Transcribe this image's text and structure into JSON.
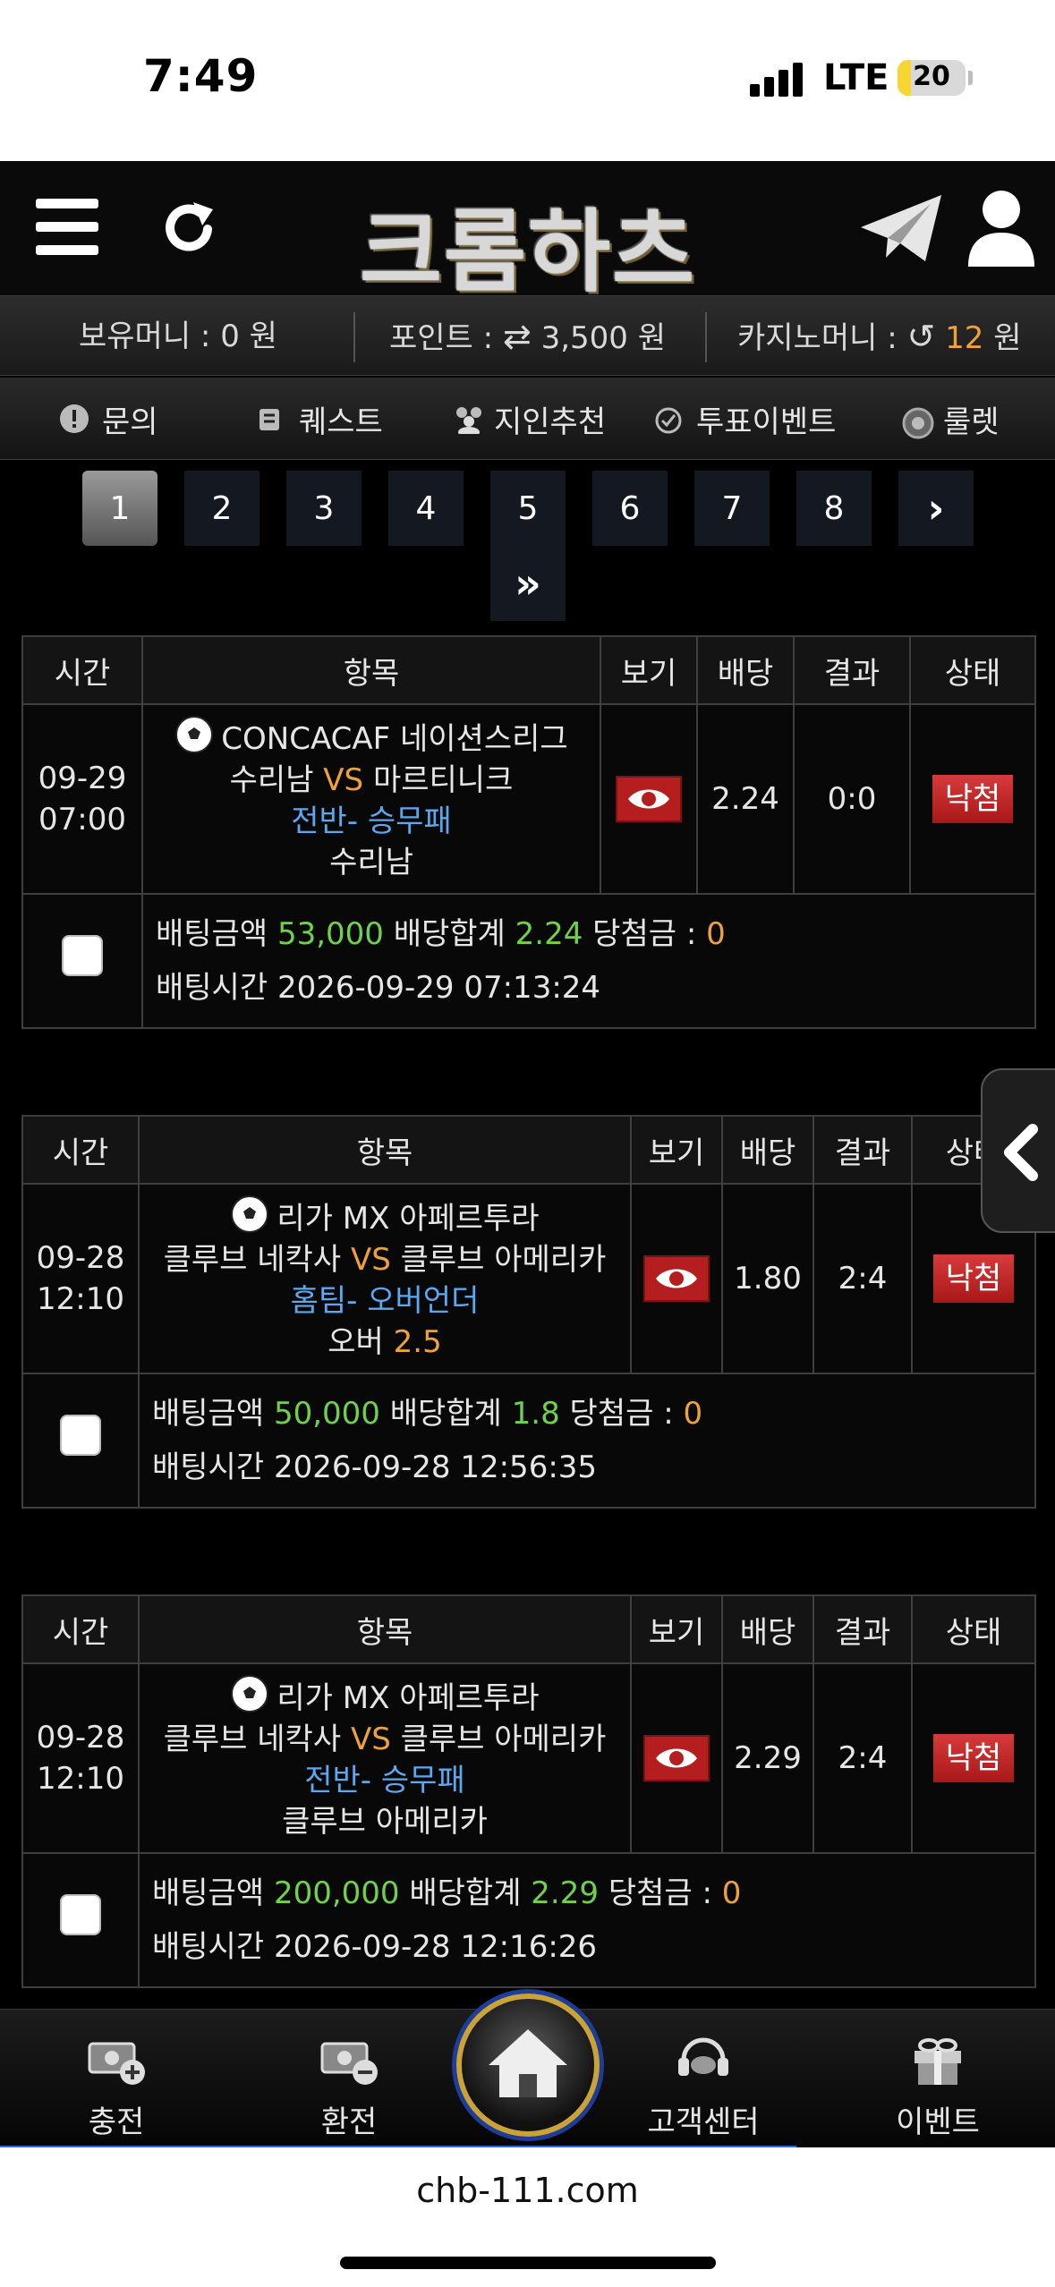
{
  "status_bar": {
    "time": "7:49",
    "network": "LTE",
    "battery": "20",
    "battery_level": 0.2
  },
  "header": {
    "logo_text": "크롬하츠",
    "icons": [
      "menu-icon",
      "refresh-icon",
      "telegram-icon",
      "user-icon"
    ]
  },
  "wallet": {
    "money_label": "보유머니 : 0 원",
    "point_label": "포인트 :",
    "point_value": "3,500 원",
    "casino_label": "카지노머니 :",
    "casino_value": "12",
    "casino_unit": "원"
  },
  "nav": {
    "items": [
      {
        "label": "문의",
        "icon": "alert-icon"
      },
      {
        "label": "퀘스트",
        "icon": "quest-icon"
      },
      {
        "label": "지인추천",
        "icon": "friends-icon"
      },
      {
        "label": "투표이벤트",
        "icon": "vote-icon"
      },
      {
        "label": "룰렛",
        "icon": "roulette-icon"
      }
    ]
  },
  "pagination": {
    "pages": [
      "1",
      "2",
      "3",
      "4",
      "5",
      "6",
      "7",
      "8"
    ],
    "current": "1",
    "next": "›",
    "last": "»"
  },
  "table_headers": {
    "time": "시간",
    "item": "항목",
    "view": "보기",
    "odds": "배당",
    "result": "결과",
    "status": "상태"
  },
  "bets": [
    {
      "date": "09-29",
      "clock": "07:00",
      "league": "CONCACAF 네이션스리그",
      "home": "수리남",
      "vs": "VS",
      "away": "마르티니크",
      "market": "전반- 승무패",
      "pick": "수리남",
      "pick_value": "",
      "odds": "2.24",
      "result": "0:0",
      "status": "낙첨",
      "amount_label": "배팅금액",
      "amount": "53,000",
      "total_label": "배당합계",
      "total": "2.24",
      "win_label": "당첨금 :",
      "win": "0",
      "time_label": "배팅시간",
      "bet_time": "2026-09-29 07:13:24"
    },
    {
      "date": "09-28",
      "clock": "12:10",
      "league": "리가 MX 아페르투라",
      "home": "클루브 네칵사",
      "vs": "VS",
      "away": "클루브 아메리카",
      "market": "홈팀- 오버언더",
      "pick": "오버",
      "pick_value": "2.5",
      "odds": "1.80",
      "result": "2:4",
      "status": "낙첨",
      "amount_label": "배팅금액",
      "amount": "50,000",
      "total_label": "배당합계",
      "total": "1.8",
      "win_label": "당첨금 :",
      "win": "0",
      "time_label": "배팅시간",
      "bet_time": "2026-09-28 12:56:35"
    },
    {
      "date": "09-28",
      "clock": "12:10",
      "league": "리가 MX 아페르투라",
      "home": "클루브 네칵사",
      "vs": "VS",
      "away": "클루브 아메리카",
      "market": "전반- 승무패",
      "pick": "클루브 아메리카",
      "pick_value": "",
      "odds": "2.29",
      "result": "2:4",
      "status": "낙첨",
      "amount_label": "배팅금액",
      "amount": "200,000",
      "total_label": "배당합계",
      "total": "2.29",
      "win_label": "당첨금 :",
      "win": "0",
      "time_label": "배팅시간",
      "bet_time": "2026-09-28 12:16:26"
    }
  ],
  "bottom_nav": {
    "deposit": "충전",
    "withdraw": "환전",
    "home_icon": "home-icon",
    "support": "고객센터",
    "event": "이벤트"
  },
  "browser": {
    "url": "chb-111.com"
  },
  "colors": {
    "accent_green": "#6fd24a",
    "accent_orange": "#f0a23a",
    "accent_blue": "#5aa9f0",
    "status_red": "#c02424"
  }
}
